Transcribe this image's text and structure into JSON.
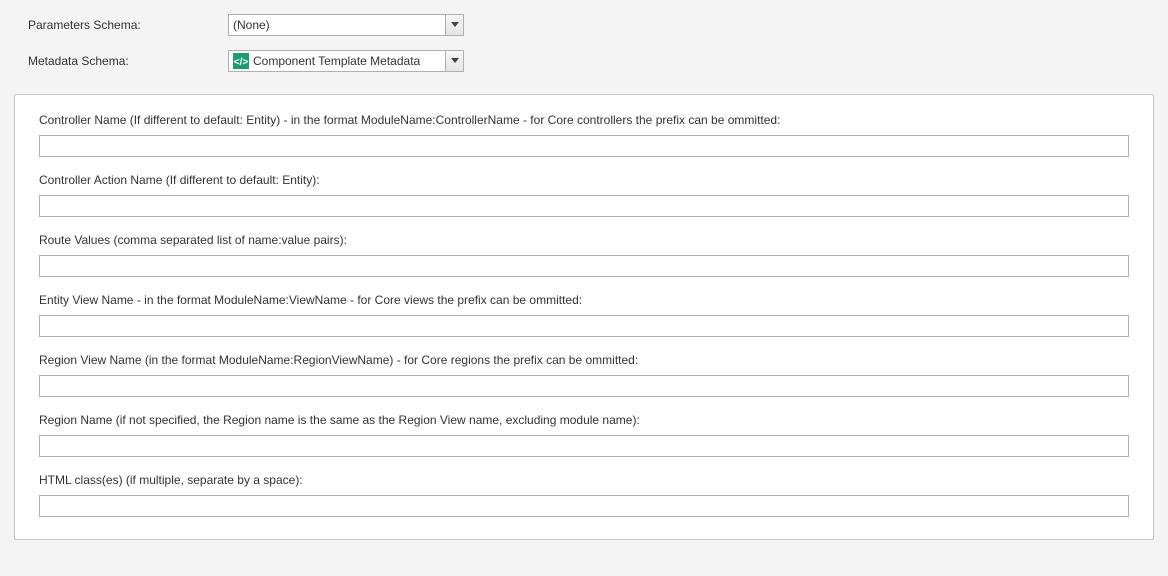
{
  "topSchemas": {
    "parametersLabel": "Parameters Schema:",
    "parametersValue": "(None)",
    "metadataLabel": "Metadata Schema:",
    "metadataValue": "Component Template Metadata"
  },
  "fields": {
    "controllerName": {
      "label": "Controller Name (If different to default: Entity) - in the format ModuleName:ControllerName - for Core controllers the prefix can be ommitted:",
      "value": ""
    },
    "controllerActionName": {
      "label": "Controller Action Name (If different to default: Entity):",
      "value": ""
    },
    "routeValues": {
      "label": "Route Values (comma separated list of name:value pairs):",
      "value": ""
    },
    "entityViewName": {
      "label": "Entity View Name - in the format ModuleName:ViewName - for Core views the prefix can be ommitted:",
      "value": ""
    },
    "regionViewName": {
      "label": "Region View Name (in the format ModuleName:RegionViewName) - for Core regions the prefix can be ommitted:",
      "value": ""
    },
    "regionName": {
      "label": "Region Name (if not specified, the Region name is the same as the Region View name, excluding module name):",
      "value": ""
    },
    "htmlClasses": {
      "label": "HTML class(es) (if multiple, separate by a space):",
      "value": ""
    }
  }
}
